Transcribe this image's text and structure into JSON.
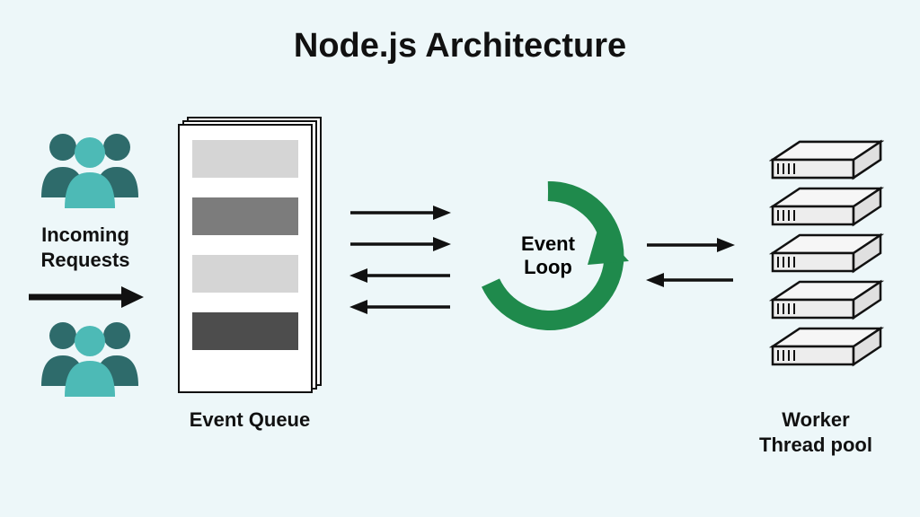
{
  "title": "Node.js Architecture",
  "incoming_label": "Incoming\nRequests",
  "queue_label": "Event Queue",
  "loop_label": "Event\nLoop",
  "pool_label": "Worker\nThread pool",
  "colors": {
    "accent_green": "#1f8a4c",
    "teal_dark": "#2e6b6b",
    "teal_light": "#4dbab6",
    "bg": "#edf7f9"
  },
  "diagram": {
    "components": [
      "Incoming Requests",
      "Event Queue",
      "Event Loop",
      "Worker Thread pool"
    ],
    "flows": [
      {
        "from": "Incoming Requests",
        "to": "Event Queue",
        "dir": "right"
      },
      {
        "from": "Event Queue",
        "to": "Event Loop",
        "dir": "bidirectional"
      },
      {
        "from": "Event Loop",
        "to": "Worker Thread pool",
        "dir": "bidirectional"
      }
    ],
    "queue_items": 4,
    "thread_pool_size": 5
  }
}
